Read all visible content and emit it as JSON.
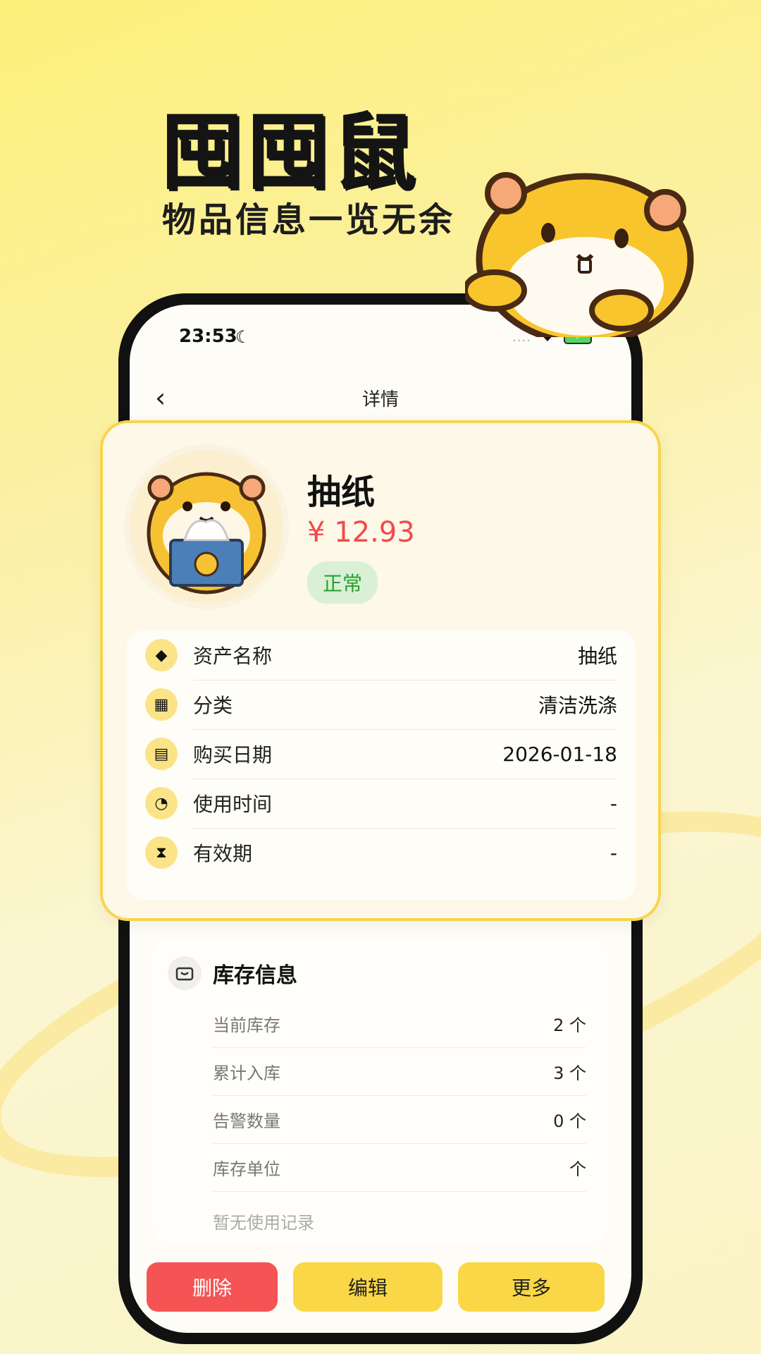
{
  "promo": {
    "title": "囤囤鼠",
    "subtitle": "物品信息一览无余"
  },
  "status_bar": {
    "time": "23:53",
    "signal": "....",
    "icons": [
      "moon-icon",
      "wifi-icon",
      "battery-charging-icon"
    ]
  },
  "nav": {
    "back_icon": "‹",
    "title": "详情"
  },
  "item": {
    "name": "抽纸",
    "price": "¥ 12.93",
    "status": "正常",
    "status_color": "#27a02d"
  },
  "info": {
    "rows": [
      {
        "icon": "tag-icon",
        "label": "资产名称",
        "value": "抽纸"
      },
      {
        "icon": "category-grid-icon",
        "label": "分类",
        "value": "清洁洗涤"
      },
      {
        "icon": "calendar-icon",
        "label": "购买日期",
        "value": "2026-01-18"
      },
      {
        "icon": "alarm-clock-icon",
        "label": "使用时间",
        "value": "-"
      },
      {
        "icon": "hourglass-icon",
        "label": "有效期",
        "value": "-"
      }
    ]
  },
  "stock": {
    "title": "库存信息",
    "rows": [
      {
        "label": "当前库存",
        "value": "2 个"
      },
      {
        "label": "累计入库",
        "value": "3 个"
      },
      {
        "label": "告警数量",
        "value": "0 个"
      },
      {
        "label": "库存单位",
        "value": "个"
      }
    ],
    "empty_note": "暂无使用记录"
  },
  "actions": {
    "delete": "删除",
    "edit": "编辑",
    "more": "更多"
  },
  "colors": {
    "accent": "#fad746",
    "danger": "#f55454",
    "price": "#f24a4a"
  }
}
